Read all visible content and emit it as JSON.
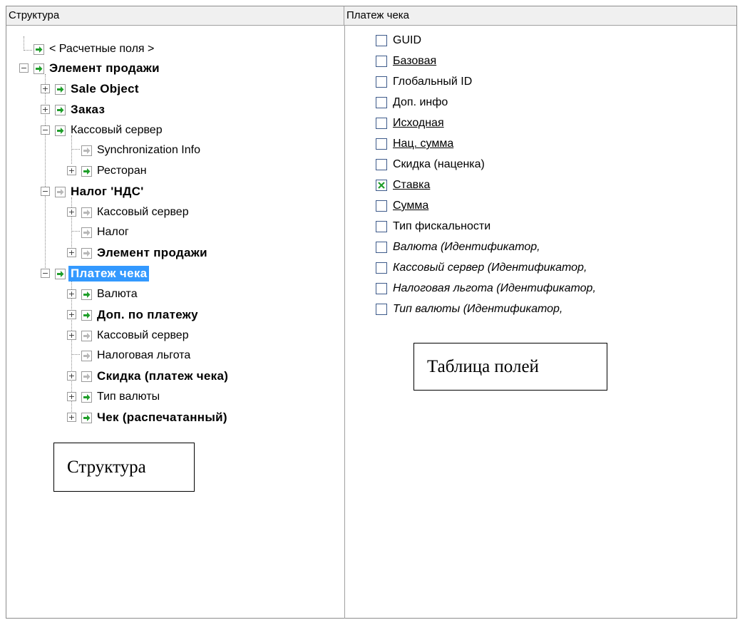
{
  "headers": {
    "structure": "Структура",
    "fields": "Платеж чека"
  },
  "tree": [
    {
      "label": "< Расчетные поля >",
      "icon": "green-arrow-icon"
    },
    {
      "label": "Элемент продажи",
      "icon": "green-arrow-icon",
      "bold": true,
      "expander": "minus"
    },
    {
      "label": "Sale Object",
      "icon": "green-arrow-icon",
      "bold": true,
      "expander": "plus"
    },
    {
      "label": "Заказ",
      "icon": "green-arrow-icon",
      "bold": true,
      "expander": "plus"
    },
    {
      "label": "Кассовый сервер",
      "icon": "green-arrow-icon",
      "expander": "minus"
    },
    {
      "label": "Synchronization Info",
      "icon": "grey-arrow-icon"
    },
    {
      "label": "Ресторан",
      "icon": "green-arrow-icon",
      "expander": "plus"
    },
    {
      "label": "Налог 'НДС'",
      "icon": "grey-arrow-icon",
      "bold": true,
      "expander": "minus"
    },
    {
      "label": "Кассовый сервер",
      "icon": "grey-arrow-icon",
      "expander": "plus"
    },
    {
      "label": "Налог",
      "icon": "grey-arrow-icon"
    },
    {
      "label": "Элемент продажи",
      "icon": "grey-arrow-icon",
      "bold": true,
      "expander": "plus"
    },
    {
      "label": "Платеж чека",
      "icon": "green-arrow-icon",
      "bold": true,
      "selected": true,
      "expander": "minus"
    },
    {
      "label": "Валюта",
      "icon": "green-arrow-icon",
      "expander": "plus"
    },
    {
      "label": "Доп. по платежу",
      "icon": "green-arrow-icon",
      "bold": true,
      "expander": "plus"
    },
    {
      "label": "Кассовый сервер",
      "icon": "grey-arrow-icon",
      "expander": "plus"
    },
    {
      "label": "Налоговая льгота",
      "icon": "grey-arrow-icon"
    },
    {
      "label": "Скидка (платеж чека)",
      "icon": "grey-arrow-icon",
      "bold": true,
      "expander": "plus"
    },
    {
      "label": "Тип валюты",
      "icon": "green-arrow-icon",
      "expander": "plus"
    },
    {
      "label": "Чек (распечатанный)",
      "icon": "green-arrow-icon",
      "bold": true,
      "expander": "plus"
    }
  ],
  "fields": [
    {
      "label": "GUID",
      "checked": false
    },
    {
      "label": "Базовая",
      "checked": false,
      "underline": true
    },
    {
      "label": "Глобальный ID",
      "checked": false
    },
    {
      "label": "Доп. инфо",
      "checked": false
    },
    {
      "label": "Исходная",
      "checked": false,
      "underline": true
    },
    {
      "label": "Нац. сумма",
      "checked": false,
      "underline": true
    },
    {
      "label": "Скидка (наценка)",
      "checked": false
    },
    {
      "label": "Ставка",
      "checked": true,
      "underline": true
    },
    {
      "label": "Сумма",
      "checked": false,
      "underline": true
    },
    {
      "label": "Тип фискальности",
      "checked": false
    },
    {
      "label": "Валюта (Идентификатор,",
      "checked": false,
      "italic": true
    },
    {
      "label": "Кассовый сервер (Идентификатор,",
      "checked": false,
      "italic": true
    },
    {
      "label": "Налоговая льгота (Идентификатор,",
      "checked": false,
      "italic": true
    },
    {
      "label": "Тип валюты (Идентификатор,",
      "checked": false,
      "italic": true
    }
  ],
  "annotations": {
    "fields_table": "Таблица полей",
    "structure": "Структура"
  },
  "colors": {
    "selection": "#3399ff",
    "green_arrow": "#1f9e2a",
    "grey_arrow": "#b8b8b8",
    "check": "#1f9e2a"
  }
}
